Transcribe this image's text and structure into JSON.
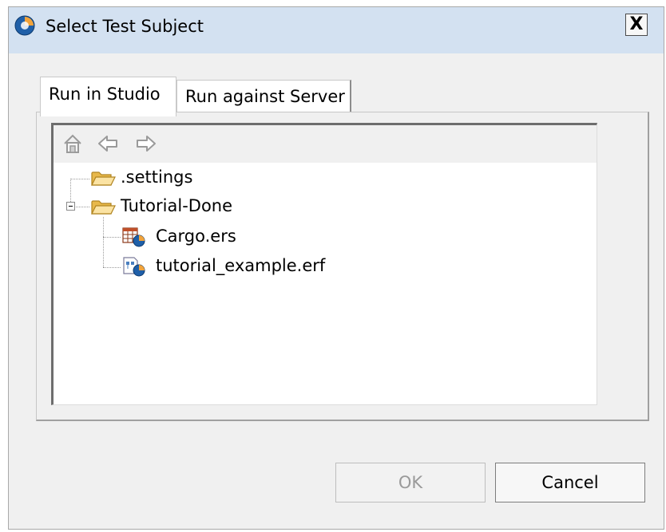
{
  "dialog": {
    "title": "Select Test Subject",
    "title_icon": "studio-app-icon",
    "close_label": "X"
  },
  "tabs": [
    {
      "label": "Run in Studio",
      "active": true
    },
    {
      "label": "Run against Server",
      "active": false
    }
  ],
  "navigation": {
    "home_icon": "home-icon",
    "back_icon": "back-arrow-icon",
    "forward_icon": "forward-arrow-icon"
  },
  "tree": {
    "nodes": [
      {
        "label": ".settings",
        "icon": "folder-open-icon",
        "level": 0
      },
      {
        "label": "Tutorial-Done",
        "icon": "folder-open-icon",
        "level": 0,
        "expanded": true
      },
      {
        "label": "Cargo.ers",
        "icon": "ruleset-file-icon",
        "level": 1
      },
      {
        "label": "tutorial_example.erf",
        "icon": "ruleflow-file-icon",
        "level": 1
      }
    ]
  },
  "buttons": {
    "ok_label": "OK",
    "ok_enabled": false,
    "cancel_label": "Cancel"
  },
  "colors": {
    "titlebar": "#d3e1f1",
    "dialog_background": "#f0f0f0",
    "disabled_text": "#9a9a9a"
  }
}
